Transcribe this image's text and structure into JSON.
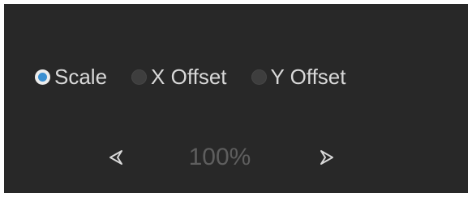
{
  "adjust": {
    "modes": [
      {
        "label": "Scale",
        "selected": true
      },
      {
        "label": "X Offset",
        "selected": false
      },
      {
        "label": "Y Offset",
        "selected": false
      }
    ],
    "value": "100%",
    "decrease_icon": "triangle-left-outline-icon",
    "increase_icon": "triangle-right-outline-icon"
  },
  "colors": {
    "panel_background": "#282828",
    "label_text": "#d8d8d8",
    "value_text": "#5e5e5e",
    "radio_accent": "#3a8fd1"
  }
}
